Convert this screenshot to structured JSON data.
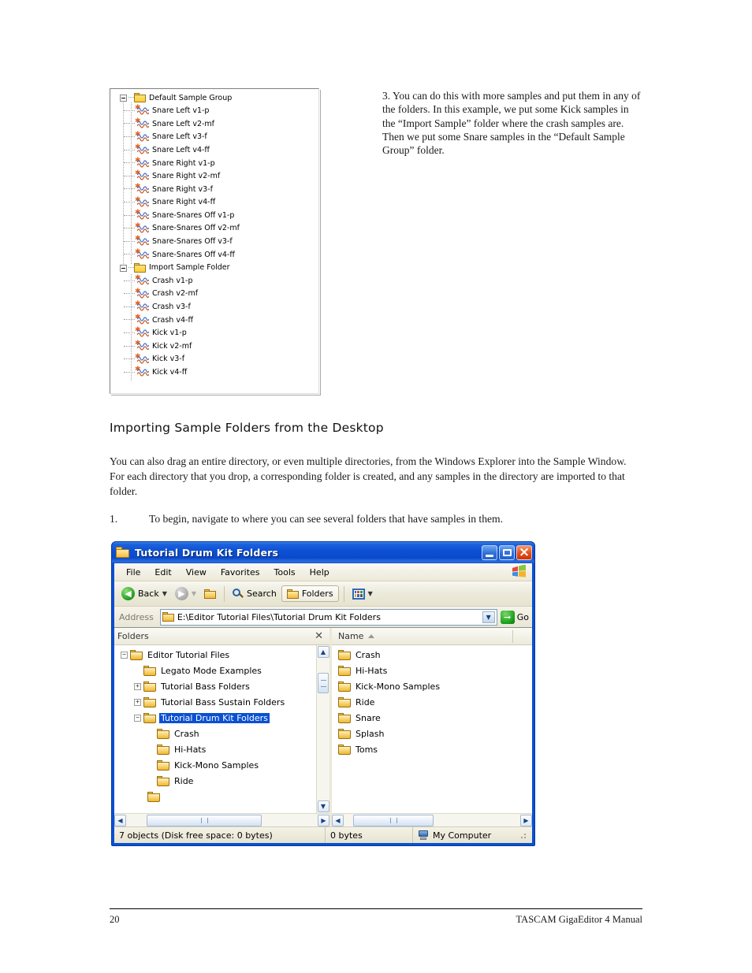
{
  "page": {
    "number": "20",
    "footer_right": "TASCAM GigaEditor 4 Manual"
  },
  "step3_paragraph": "3. You can do this with more samples and put them in any of the folders.  In this example, we put some Kick samples in the “Import Sample” folder where the crash samples are. Then we put some Snare samples in the “Default Sample Group” folder.",
  "section": {
    "heading": "Importing Sample Folders from the Desktop",
    "intro": "You can also drag an entire directory, or even multiple directories, from the Windows Explorer into the Sample Window.  For each directory that you drop, a corresponding folder is created, and any samples in the directory are imported to that folder.",
    "step1_number": "1.",
    "step1_text": "To begin, navigate to where you can see several folders that have samples in them."
  },
  "sample_tree": {
    "rows": [
      {
        "type": "folder",
        "depth": 0,
        "label": "Default Sample Group",
        "expander": "minus"
      },
      {
        "type": "sample",
        "depth": 1,
        "label": "Snare Left v1-p"
      },
      {
        "type": "sample",
        "depth": 1,
        "label": "Snare Left v2-mf"
      },
      {
        "type": "sample",
        "depth": 1,
        "label": "Snare Left v3-f"
      },
      {
        "type": "sample",
        "depth": 1,
        "label": "Snare Left v4-ff"
      },
      {
        "type": "sample",
        "depth": 1,
        "label": "Snare Right v1-p"
      },
      {
        "type": "sample",
        "depth": 1,
        "label": "Snare Right v2-mf"
      },
      {
        "type": "sample",
        "depth": 1,
        "label": "Snare Right v3-f"
      },
      {
        "type": "sample",
        "depth": 1,
        "label": "Snare Right v4-ff"
      },
      {
        "type": "sample",
        "depth": 1,
        "label": "Snare-Snares Off v1-p"
      },
      {
        "type": "sample",
        "depth": 1,
        "label": "Snare-Snares Off v2-mf"
      },
      {
        "type": "sample",
        "depth": 1,
        "label": "Snare-Snares Off v3-f"
      },
      {
        "type": "sample",
        "depth": 1,
        "label": "Snare-Snares Off v4-ff"
      },
      {
        "type": "folder",
        "depth": 0,
        "label": "Import Sample Folder",
        "expander": "minus"
      },
      {
        "type": "sample",
        "depth": 1,
        "label": "Crash v1-p"
      },
      {
        "type": "sample",
        "depth": 1,
        "label": "Crash v2-mf"
      },
      {
        "type": "sample",
        "depth": 1,
        "label": "Crash v3-f"
      },
      {
        "type": "sample",
        "depth": 1,
        "label": "Crash v4-ff"
      },
      {
        "type": "sample",
        "depth": 1,
        "label": "Kick v1-p"
      },
      {
        "type": "sample",
        "depth": 1,
        "label": "Kick v2-mf"
      },
      {
        "type": "sample",
        "depth": 1,
        "label": "Kick v3-f"
      },
      {
        "type": "sample",
        "depth": 1,
        "label": "Kick v4-ff"
      }
    ]
  },
  "explorer": {
    "title": "Tutorial Drum Kit Folders",
    "window_buttons": {
      "minimize": "minimize-button",
      "maximize": "maximize-button",
      "close": "close-button"
    },
    "menu": [
      "File",
      "Edit",
      "View",
      "Favorites",
      "Tools",
      "Help"
    ],
    "toolbar": {
      "back": "Back",
      "search": "Search",
      "folders": "Folders"
    },
    "address": {
      "label": "Address",
      "value": "E:\\Editor Tutorial Files\\Tutorial Drum Kit Folders",
      "go": "Go"
    },
    "left_pane": {
      "header": "Folders",
      "items": [
        {
          "label": "Editor Tutorial Files",
          "depth": 1,
          "expander": "minus",
          "selected": false,
          "open": true
        },
        {
          "label": "Legato Mode Examples",
          "depth": 2,
          "expander": "none",
          "selected": false,
          "open": false
        },
        {
          "label": "Tutorial Bass Folders",
          "depth": 2,
          "expander": "plus",
          "selected": false,
          "open": false
        },
        {
          "label": "Tutorial Bass Sustain Folders",
          "depth": 2,
          "expander": "plus",
          "selected": false,
          "open": false
        },
        {
          "label": "Tutorial Drum Kit Folders",
          "depth": 2,
          "expander": "minus",
          "selected": true,
          "open": true
        },
        {
          "label": "Crash",
          "depth": 3,
          "expander": "none",
          "selected": false,
          "open": false
        },
        {
          "label": "Hi-Hats",
          "depth": 3,
          "expander": "none",
          "selected": false,
          "open": false
        },
        {
          "label": "Kick-Mono Samples",
          "depth": 3,
          "expander": "none",
          "selected": false,
          "open": false
        },
        {
          "label": "Ride",
          "depth": 3,
          "expander": "none",
          "selected": false,
          "open": false
        }
      ]
    },
    "right_pane": {
      "column_header": "Name",
      "items": [
        "Crash",
        "Hi-Hats",
        "Kick-Mono Samples",
        "Ride",
        "Snare",
        "Splash",
        "Toms"
      ]
    },
    "status": {
      "objects": "7 objects (Disk free space: 0 bytes)",
      "size": "0 bytes",
      "location": "My Computer"
    }
  }
}
